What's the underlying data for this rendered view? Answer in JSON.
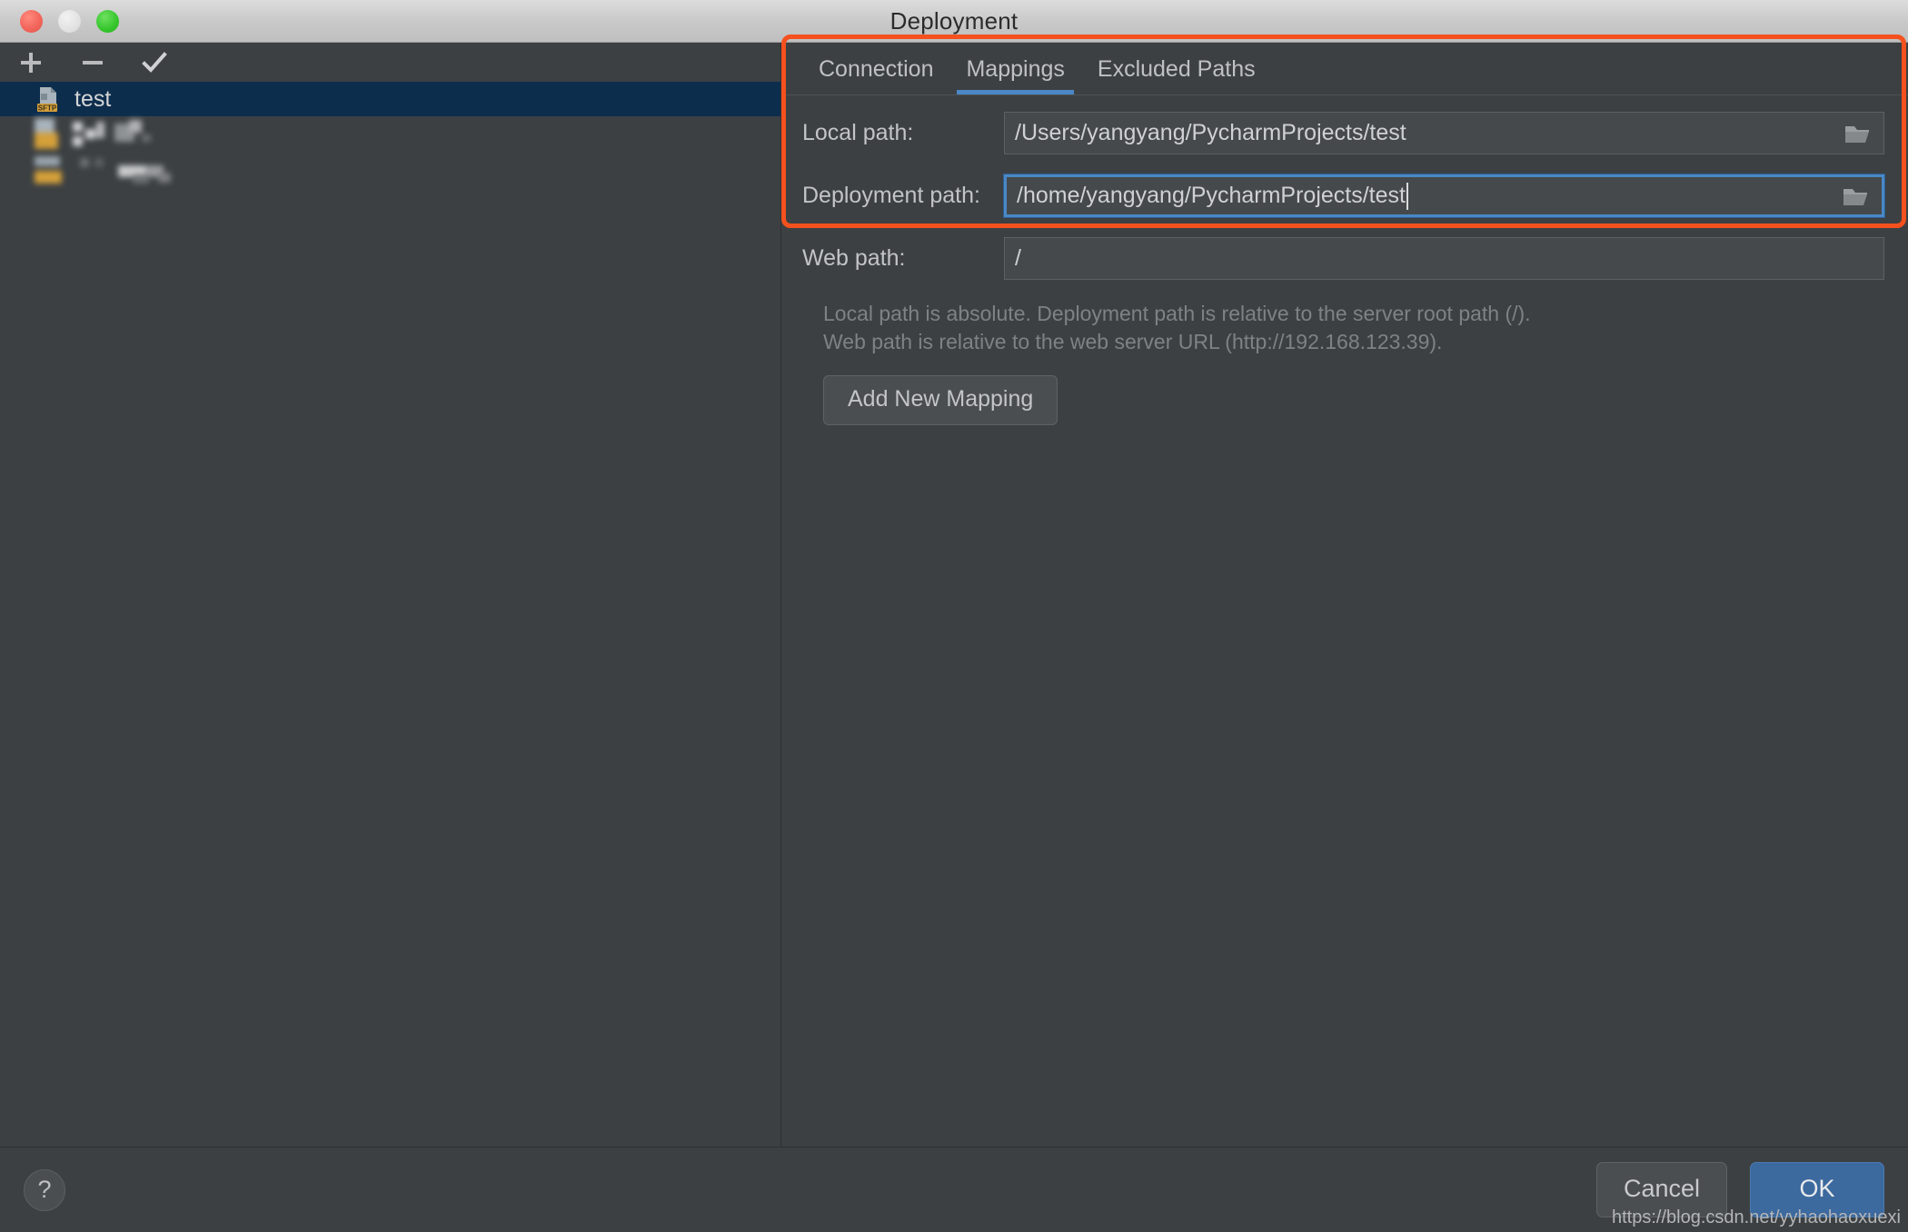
{
  "window": {
    "title": "Deployment",
    "traffic_lights": [
      {
        "name": "close",
        "color": "#f2655b"
      },
      {
        "name": "minimize",
        "color": "#e2e2e2"
      },
      {
        "name": "zoom",
        "color": "#35c52c"
      }
    ]
  },
  "sidebar": {
    "toolbar": [
      {
        "name": "add",
        "icon": "plus-icon"
      },
      {
        "name": "remove",
        "icon": "minus-icon"
      },
      {
        "name": "set-default",
        "icon": "check-icon"
      }
    ],
    "items": [
      {
        "label": "test",
        "icon": "sftp-server-icon",
        "selected": true,
        "redacted": false
      },
      {
        "label": "",
        "icon": "sftp-server-icon",
        "selected": false,
        "redacted": true
      },
      {
        "label": "",
        "icon": "sftp-server-icon",
        "selected": false,
        "redacted": true
      }
    ]
  },
  "main": {
    "tabs": [
      {
        "label": "Connection",
        "active": false
      },
      {
        "label": "Mappings",
        "active": true
      },
      {
        "label": "Excluded Paths",
        "active": false
      }
    ],
    "fields": [
      {
        "label": "Local path:",
        "value": "/Users/yangyang/PycharmProjects/test",
        "focused": false,
        "caret": false,
        "browse_icon": "folder-icon"
      },
      {
        "label": "Deployment path:",
        "value": "/home/yangyang/PycharmProjects/test",
        "focused": true,
        "caret": true,
        "browse_icon": "folder-icon"
      },
      {
        "label": "Web path:",
        "value": "/",
        "focused": false,
        "caret": false,
        "browse_icon": ""
      }
    ],
    "help_line_1": "Local path is absolute. Deployment path is relative to the server root path (/).",
    "help_line_2": "Web path is relative to the web server URL (http://192.168.123.39).",
    "add_mapping_label": "Add New Mapping"
  },
  "footer": {
    "help_label": "?",
    "cancel_label": "Cancel",
    "ok_label": "OK"
  },
  "watermark": "https://blog.csdn.net/yyhaohaoxuexi",
  "colors": {
    "annotation": "#f4511e",
    "accent": "#4a88c7",
    "selection": "#0d2d4d",
    "ok_button": "#3c699e",
    "background": "#3c4043",
    "sftp_badge": "#d4a03a"
  }
}
